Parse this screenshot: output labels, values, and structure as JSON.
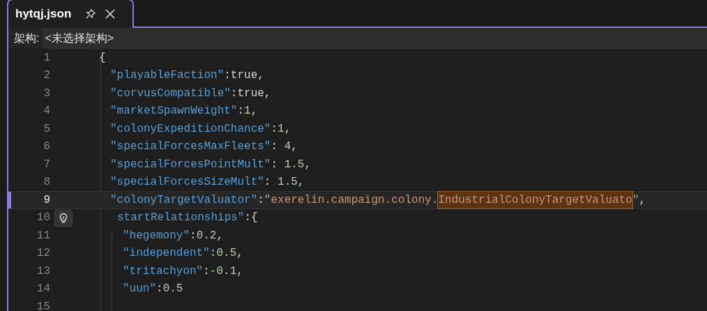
{
  "tab": {
    "title": "hytqj.json",
    "selected": true
  },
  "schema": {
    "label": "架构:",
    "value": "<未选择架构>"
  },
  "lines": [
    {
      "number": "1",
      "current": false,
      "segments": [
        {
          "kind": "punct",
          "text": "{"
        }
      ],
      "children": [
        {
          "number": "2",
          "current": false,
          "segments": [
            {
              "kind": "key",
              "text": "\"playableFaction\""
            },
            {
              "kind": "punct",
              "text": ":true,"
            }
          ]
        },
        {
          "number": "3",
          "current": false,
          "segments": [
            {
              "kind": "key",
              "text": "\"corvusCompatible\""
            },
            {
              "kind": "punct",
              "text": ":true,"
            }
          ]
        },
        {
          "number": "4",
          "current": false,
          "segments": [
            {
              "kind": "key",
              "text": "\"marketSpawnWeight\""
            },
            {
              "kind": "punct",
              "text": ":"
            },
            {
              "kind": "number",
              "text": "1"
            },
            {
              "kind": "punct",
              "text": ","
            }
          ]
        },
        {
          "number": "5",
          "current": false,
          "segments": [
            {
              "kind": "key",
              "text": "\"colonyExpeditionChance\""
            },
            {
              "kind": "punct",
              "text": ":"
            },
            {
              "kind": "number",
              "text": "1"
            },
            {
              "kind": "punct",
              "text": ","
            }
          ]
        },
        {
          "number": "6",
          "current": false,
          "segments": [
            {
              "kind": "key",
              "text": "\"specialForcesMaxFleets\""
            },
            {
              "kind": "punct",
              "text": ": "
            },
            {
              "kind": "number",
              "text": "4"
            },
            {
              "kind": "punct",
              "text": ","
            }
          ]
        },
        {
          "number": "7",
          "current": false,
          "segments": [
            {
              "kind": "key",
              "text": "\"specialForcesPointMult\""
            },
            {
              "kind": "punct",
              "text": ": "
            },
            {
              "kind": "number",
              "text": "1.5"
            },
            {
              "kind": "punct",
              "text": ","
            }
          ]
        },
        {
          "number": "8",
          "current": false,
          "segments": [
            {
              "kind": "key",
              "text": "\"specialForcesSizeMult\""
            },
            {
              "kind": "punct",
              "text": ": "
            },
            {
              "kind": "number",
              "text": "1.5"
            },
            {
              "kind": "punct",
              "text": ","
            }
          ]
        },
        {
          "number": "9",
          "current": true,
          "segments": [
            {
              "kind": "key",
              "text": "\"colonyTargetValuator\""
            },
            {
              "kind": "punct",
              "text": ":"
            },
            {
              "kind": "string",
              "text": "\"exerelin.campaign.colony."
            },
            {
              "kind": "highlight",
              "text": "IndustrialColonyTargetValuato"
            },
            {
              "kind": "string",
              "text": "\""
            },
            {
              "kind": "punct",
              "text": ","
            }
          ]
        },
        {
          "number": "10",
          "current": false,
          "lightbulb": true,
          "segments": [
            {
              "kind": "key",
              "text": "startRelationships\""
            },
            {
              "kind": "punct",
              "text": ":{"
            }
          ],
          "children": [
            {
              "number": "11",
              "current": false,
              "segments": [
                {
                  "kind": "key",
                  "text": "\"hegemony\""
                },
                {
                  "kind": "punct",
                  "text": ":"
                },
                {
                  "kind": "number",
                  "text": "0.2"
                },
                {
                  "kind": "punct",
                  "text": ","
                }
              ]
            },
            {
              "number": "12",
              "current": false,
              "segments": [
                {
                  "kind": "key",
                  "text": "\"independent\""
                },
                {
                  "kind": "punct",
                  "text": ":"
                },
                {
                  "kind": "number",
                  "text": "0.5"
                },
                {
                  "kind": "punct",
                  "text": ","
                }
              ]
            },
            {
              "number": "13",
              "current": false,
              "segments": [
                {
                  "kind": "key",
                  "text": "\"tritachyon\""
                },
                {
                  "kind": "punct",
                  "text": ":"
                },
                {
                  "kind": "number",
                  "text": "-0.1"
                },
                {
                  "kind": "punct",
                  "text": ","
                }
              ]
            },
            {
              "number": "14",
              "current": false,
              "segments": [
                {
                  "kind": "key",
                  "text": "\"uun\""
                },
                {
                  "kind": "punct",
                  "text": ":"
                },
                {
                  "kind": "number",
                  "text": "0.5"
                }
              ]
            }
          ]
        },
        {
          "number": "15",
          "current": false
        }
      ]
    }
  ]
}
